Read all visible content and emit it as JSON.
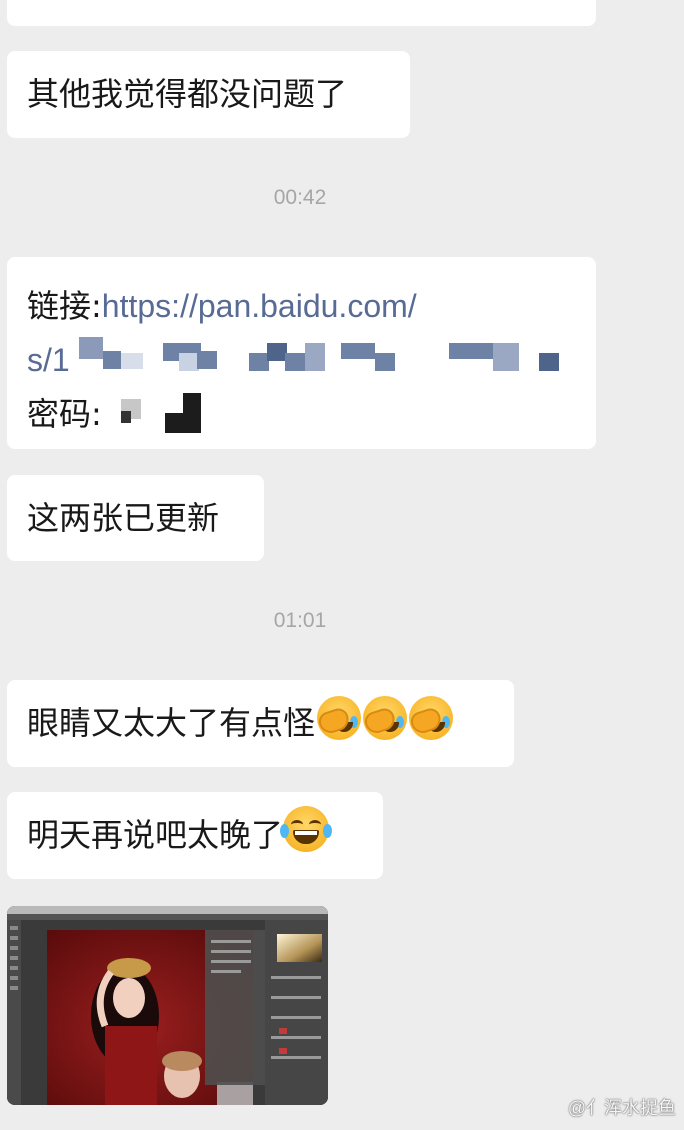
{
  "messages": [
    {
      "text": "其他我觉得都没问题了"
    },
    {
      "link_prefix": "链接:",
      "link_url_line1": "https://pan.baidu.com/",
      "link_url_line2_start": "s/1",
      "password_label": "密码:"
    },
    {
      "text": "这两张已更新"
    },
    {
      "text": "眼睛又太大了有点怪"
    },
    {
      "text": "明天再说吧太晚了"
    }
  ],
  "timestamps": [
    "00:42",
    "01:01"
  ],
  "emoji": {
    "facepalm_cry": "facepalm-crying-emoji",
    "tears_of_joy": "tears-of-joy-emoji"
  },
  "watermark": "@亻浑水捉鱼",
  "colors": {
    "background": "#ededed",
    "bubble": "#ffffff",
    "link": "#576b95",
    "timestamp": "#a6a6a6"
  }
}
